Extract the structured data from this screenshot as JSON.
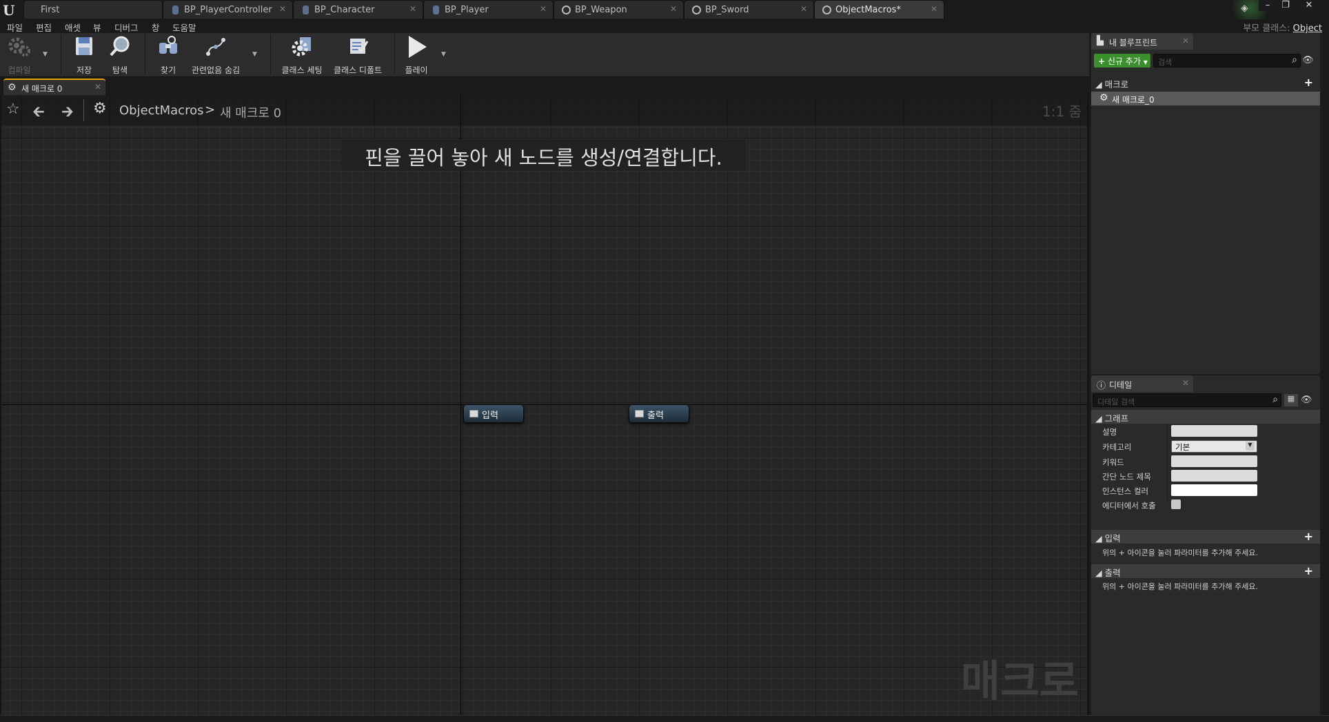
{
  "window": {
    "tabs": [
      {
        "label": "First",
        "icon": "unreal-icon"
      },
      {
        "label": "BP_PlayerController",
        "icon": "blueprint-icon"
      },
      {
        "label": "BP_Character",
        "icon": "blueprint-icon"
      },
      {
        "label": "BP_Player",
        "icon": "blueprint-icon"
      },
      {
        "label": "BP_Weapon",
        "icon": "circle-icon"
      },
      {
        "label": "BP_Sword",
        "icon": "circle-icon"
      },
      {
        "label": "ObjectMacros*",
        "icon": "circle-icon",
        "active": true
      }
    ],
    "parent_class_label": "부모 클래스:",
    "parent_class_value": "Object"
  },
  "menu": [
    "파일",
    "편집",
    "애셋",
    "뷰",
    "디버그",
    "창",
    "도움말"
  ],
  "toolbar": {
    "compile": "컴파일",
    "save": "저장",
    "browse": "탐색",
    "find": "찾기",
    "hide_unrelated": "관련없음 숨김",
    "class_settings": "클래스 세팅",
    "class_defaults": "클래스 디폴트",
    "play": "플레이"
  },
  "graph": {
    "tab_label": "새 매크로 0",
    "breadcrumb_root": "ObjectMacros",
    "breadcrumb_sep": ">",
    "breadcrumb_current": "새 매크로 0",
    "zoom": "1:1 줌",
    "hint": "핀을 끌어 놓아 새 노드를 생성/연결합니다.",
    "watermark": "매크로",
    "nodes": [
      {
        "label": "입력"
      },
      {
        "label": "출력"
      }
    ]
  },
  "my_blueprint": {
    "tab_label": "내 블루프린트",
    "add_new": "신규 추가",
    "search_placeholder": "검색",
    "macros_section": "매크로",
    "macro_item": "새 매크로_0"
  },
  "details": {
    "tab_label": "디테일",
    "search_placeholder": "디테일 검색",
    "graph_section": "그래프",
    "props": {
      "description": "설명",
      "category": "카테고리",
      "category_value": "기본",
      "keywords": "키워드",
      "compact_title": "간단 노드 제목",
      "instance_color": "인스턴스 컬러",
      "call_in_editor": "에디터에서 호출"
    },
    "inputs_section": "입력",
    "inputs_help": "위의 + 아이콘을 눌러 파라미터를 추가해 주세요.",
    "outputs_section": "출력",
    "outputs_help": "위의 + 아이콘을 눌러 파라미터를 추가해 주세요."
  }
}
